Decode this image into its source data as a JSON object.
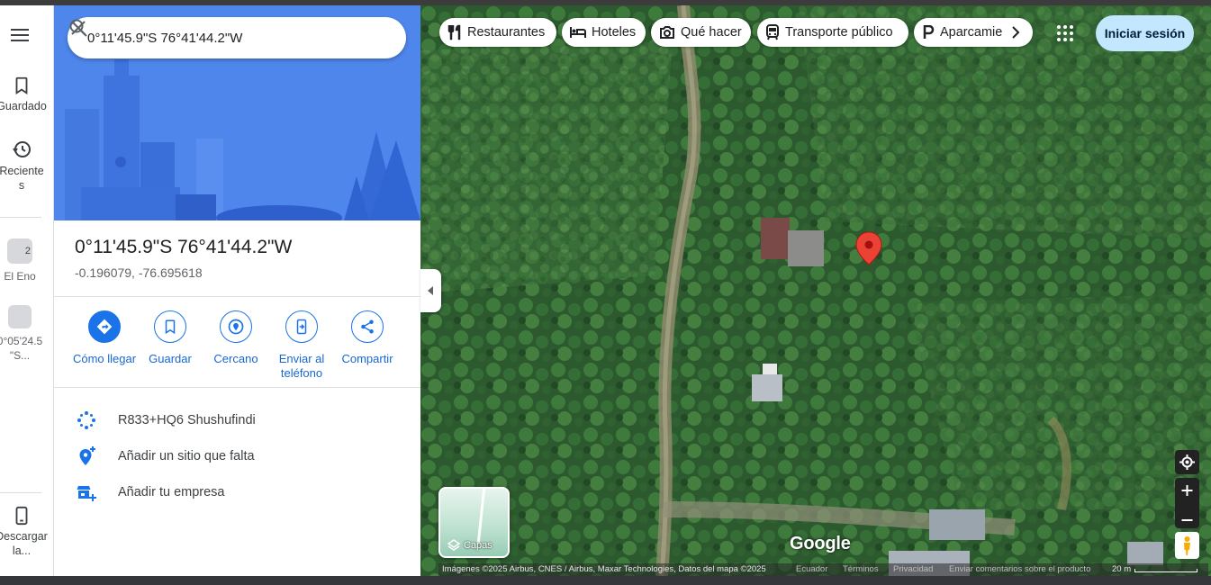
{
  "search": {
    "value": "0°11'45.9\"S 76°41'44.2\"W"
  },
  "rail": {
    "saved_label": "Guardado",
    "recent_label_1": "Reciente",
    "recent_label_2": "s",
    "recent_place_1": {
      "label": "El Eno",
      "badge": "2"
    },
    "recent_place_2": {
      "label_1": "0°05'24.5",
      "label_2": "\"S..."
    },
    "download_label_1": "Descargar",
    "download_label_2": "la..."
  },
  "place": {
    "title": "0°11'45.9\"S 76°41'44.2\"W",
    "coords": "-0.196079, -76.695618"
  },
  "actions": [
    {
      "label": "Cómo llegar",
      "icon": "directions-icon"
    },
    {
      "label": "Guardar",
      "icon": "bookmark-icon"
    },
    {
      "label": "Cercano",
      "icon": "nearby-icon"
    },
    {
      "label_1": "Enviar al",
      "label_2": "teléfono",
      "icon": "send-to-phone-icon"
    },
    {
      "label": "Compartir",
      "icon": "share-icon"
    }
  ],
  "info": {
    "plus_code": "R833+HQ6 Shushufindi",
    "add_missing_place": "Añadir un sitio que falta",
    "add_business": "Añadir tu empresa"
  },
  "chips": [
    {
      "label": "Restaurantes",
      "icon": "restaurant-icon"
    },
    {
      "label": "Hoteles",
      "icon": "hotel-icon"
    },
    {
      "label": "Qué hacer",
      "icon": "camera-icon"
    },
    {
      "label": "Transporte público",
      "icon": "transit-icon"
    },
    {
      "label": "Aparcamie",
      "icon": "parking-icon"
    }
  ],
  "signin_label": "Iniciar sesión",
  "layers_label": "Capas",
  "google_logo": "Google",
  "attribution": {
    "imagery": "Imágenes ©2025 Airbus, CNES / Airbus, Maxar Technologies, Datos del mapa ©2025",
    "country": "Ecuador",
    "terms": "Términos",
    "privacy": "Privacidad",
    "feedback": "Enviar comentarios sobre el producto",
    "scale": "20 m"
  },
  "colors": {
    "accent": "#1a73e8",
    "pin": "#ea4335",
    "signin_bg": "#c2e7ff"
  }
}
